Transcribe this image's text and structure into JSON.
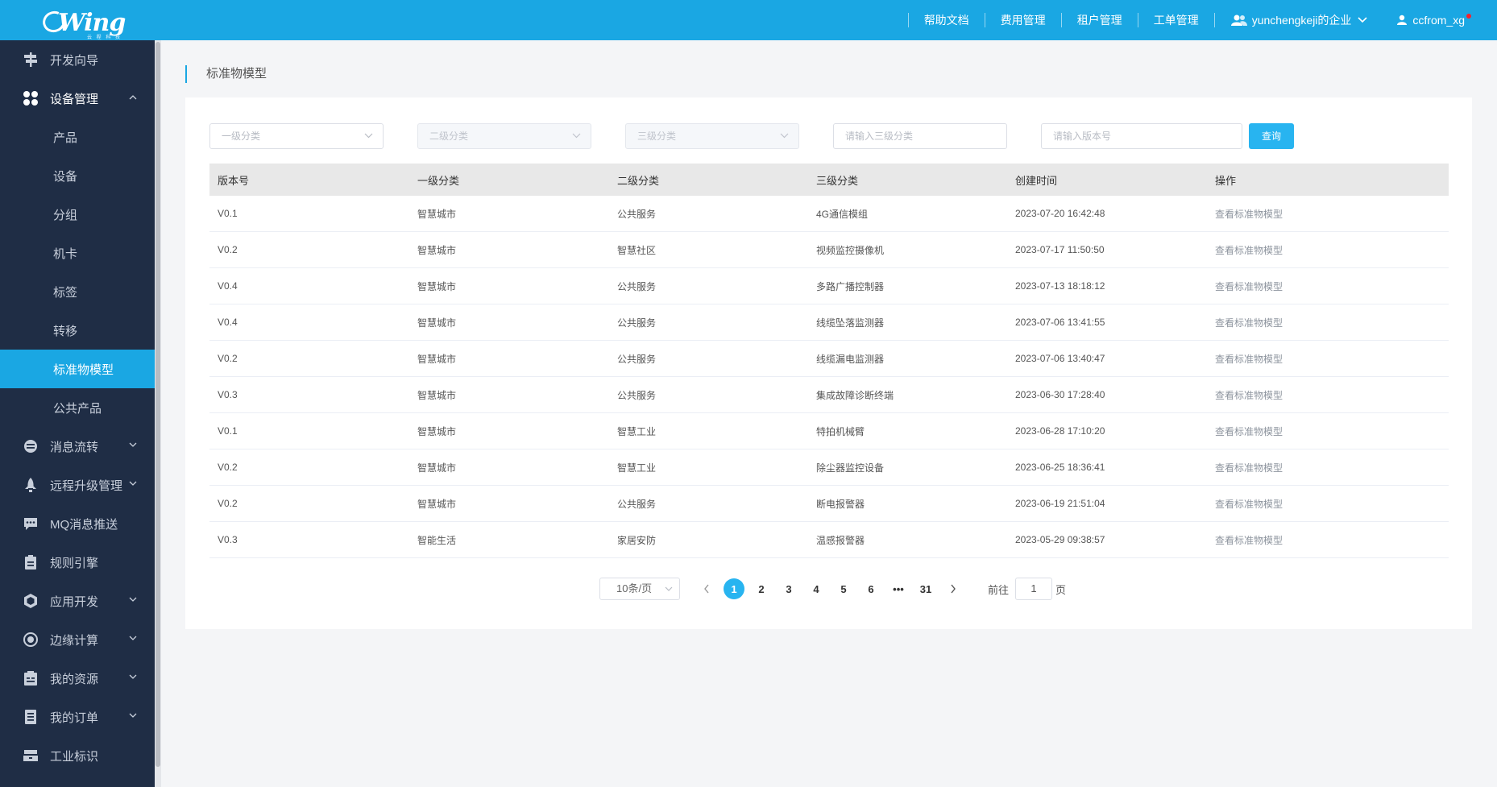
{
  "header": {
    "logo_text": "Wing",
    "logo_subtext": "云 程 科 技",
    "nav": [
      "帮助文档",
      "费用管理",
      "租户管理",
      "工单管理"
    ],
    "enterprise": "yunchengkeji的企业",
    "username": "ccfrom_xg",
    "accent": "#1aa7e3"
  },
  "sidebar": {
    "items": [
      {
        "label": "开发向导",
        "icon": "signpost-icon"
      },
      {
        "label": "设备管理",
        "icon": "grid-icon",
        "expanded": true,
        "children": [
          "产品",
          "设备",
          "分组",
          "机卡",
          "标签",
          "转移",
          "标准物模型",
          "公共产品"
        ],
        "active_child": "标准物模型"
      },
      {
        "label": "消息流转",
        "icon": "flow-icon",
        "has_children": true
      },
      {
        "label": "远程升级管理",
        "icon": "rocket-icon",
        "has_children": true
      },
      {
        "label": "MQ消息推送",
        "icon": "message-icon"
      },
      {
        "label": "规则引擎",
        "icon": "rule-icon"
      },
      {
        "label": "应用开发",
        "icon": "cube-icon",
        "has_children": true
      },
      {
        "label": "边缘计算",
        "icon": "edge-icon",
        "has_children": true
      },
      {
        "label": "我的资源",
        "icon": "resource-icon",
        "has_children": true
      },
      {
        "label": "我的订单",
        "icon": "order-icon",
        "has_children": true
      },
      {
        "label": "工业标识",
        "icon": "industry-icon"
      }
    ]
  },
  "page": {
    "breadcrumb": "标准物模型"
  },
  "filters": {
    "level1_placeholder": "一级分类",
    "level2_placeholder": "二级分类",
    "level3_placeholder": "三级分类",
    "level3_input_placeholder": "请输入三级分类",
    "version_input_placeholder": "请输入版本号",
    "query_label": "查询"
  },
  "table": {
    "columns": [
      "版本号",
      "一级分类",
      "二级分类",
      "三级分类",
      "创建时间",
      "操作"
    ],
    "rows": [
      [
        "V0.1",
        "智慧城市",
        "公共服务",
        "4G通信模组",
        "2023-07-20 16:42:48",
        "查看标准物模型"
      ],
      [
        "V0.2",
        "智慧城市",
        "智慧社区",
        "视频监控摄像机",
        "2023-07-17 11:50:50",
        "查看标准物模型"
      ],
      [
        "V0.4",
        "智慧城市",
        "公共服务",
        "多路广播控制器",
        "2023-07-13 18:18:12",
        "查看标准物模型"
      ],
      [
        "V0.4",
        "智慧城市",
        "公共服务",
        "线缆坠落监测器",
        "2023-07-06 13:41:55",
        "查看标准物模型"
      ],
      [
        "V0.2",
        "智慧城市",
        "公共服务",
        "线缆漏电监测器",
        "2023-07-06 13:40:47",
        "查看标准物模型"
      ],
      [
        "V0.3",
        "智慧城市",
        "公共服务",
        "集成故障诊断终端",
        "2023-06-30 17:28:40",
        "查看标准物模型"
      ],
      [
        "V0.1",
        "智慧城市",
        "智慧工业",
        "特拍机械臂",
        "2023-06-28 17:10:20",
        "查看标准物模型"
      ],
      [
        "V0.2",
        "智慧城市",
        "智慧工业",
        "除尘器监控设备",
        "2023-06-25 18:36:41",
        "查看标准物模型"
      ],
      [
        "V0.2",
        "智慧城市",
        "公共服务",
        "断电报警器",
        "2023-06-19 21:51:04",
        "查看标准物模型"
      ],
      [
        "V0.3",
        "智能生活",
        "家居安防",
        "温感报警器",
        "2023-05-29 09:38:57",
        "查看标准物模型"
      ]
    ]
  },
  "pagination": {
    "page_size": "10条/页",
    "pages": [
      "1",
      "2",
      "3",
      "4",
      "5",
      "6",
      "•••",
      "31"
    ],
    "current": "1",
    "goto_prefix": "前往",
    "goto_value": "1",
    "goto_suffix": "页"
  }
}
